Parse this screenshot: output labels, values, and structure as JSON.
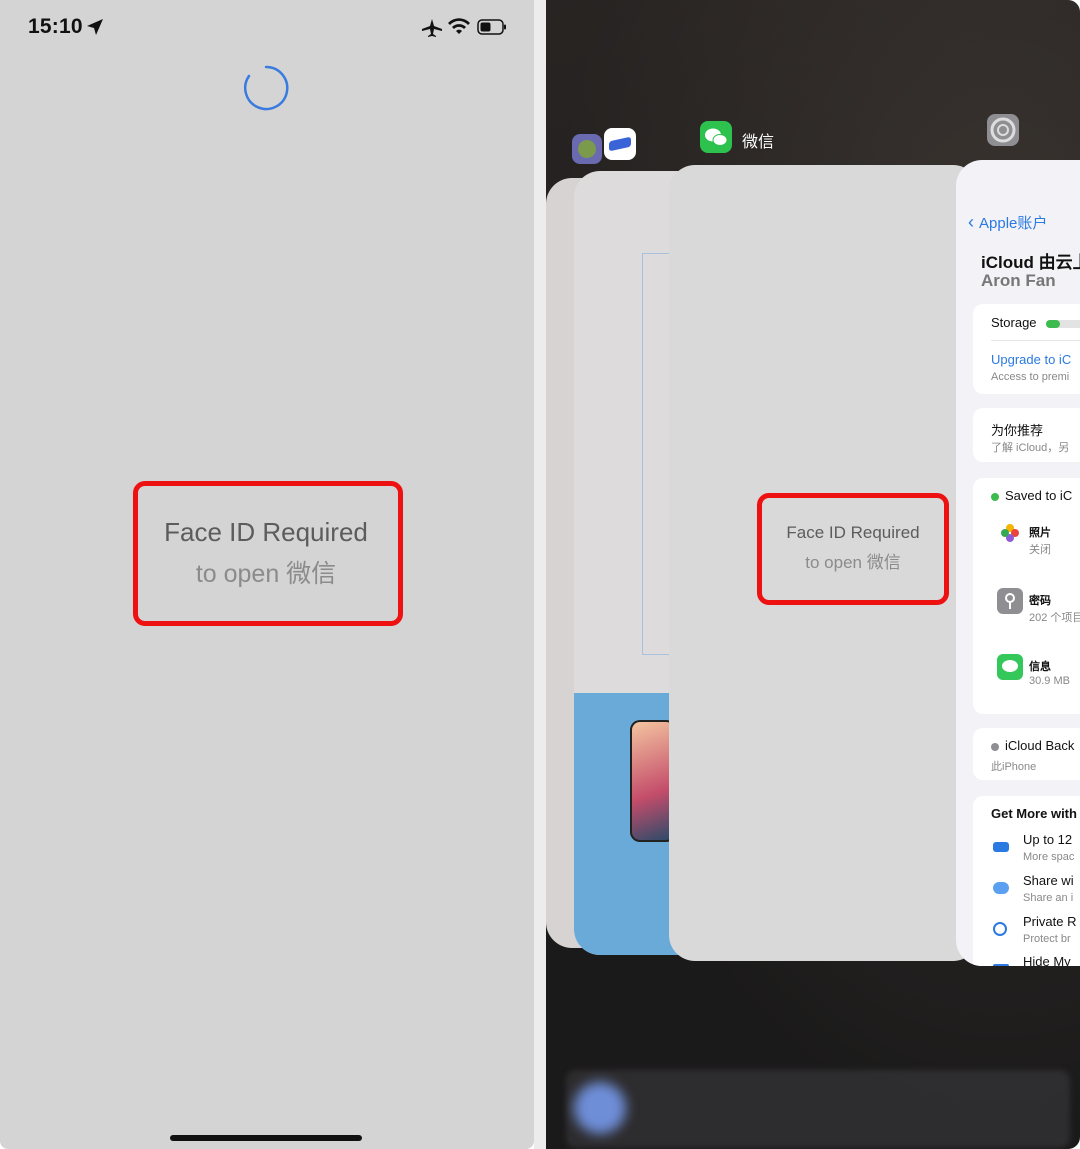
{
  "left_screen": {
    "status_time": "15:10",
    "face_id_title": "Face ID Required",
    "face_id_subtitle": "to open 微信"
  },
  "app_switcher": {
    "wechat_label": "微信",
    "main_card": {
      "face_id_title": "Face ID Required",
      "face_id_subtitle": "to open 微信"
    },
    "settings_card": {
      "back_label": "Apple账户",
      "title": "iCloud 由云上",
      "user_name": "Aron Fan",
      "storage_label": "Storage",
      "upgrade_label": "Upgrade to iC",
      "upgrade_sub": "Access to premi",
      "recommend_label": "为你推荐",
      "recommend_sub": "了解 iCloud，另",
      "saved_label": "Saved to iC",
      "photos_label": "照片",
      "photos_sub": "关闭",
      "passwords_label": "密码",
      "passwords_sub": "202 个项目",
      "messages_label": "信息",
      "messages_sub": "30.9 MB",
      "backup_label": "iCloud Back",
      "backup_sub": "此iPhone",
      "get_more_label": "Get More with",
      "upto_label": "Up to 12",
      "upto_sub": "More spac",
      "share_label": "Share wi",
      "share_sub": "Share an i",
      "private_label": "Private R",
      "private_sub": "Protect br",
      "hide_label": "Hide My"
    }
  },
  "colors": {
    "highlight_red": "#ee1111",
    "ios_blue": "#2a7ae2",
    "wechat_green": "#2dc14e"
  }
}
